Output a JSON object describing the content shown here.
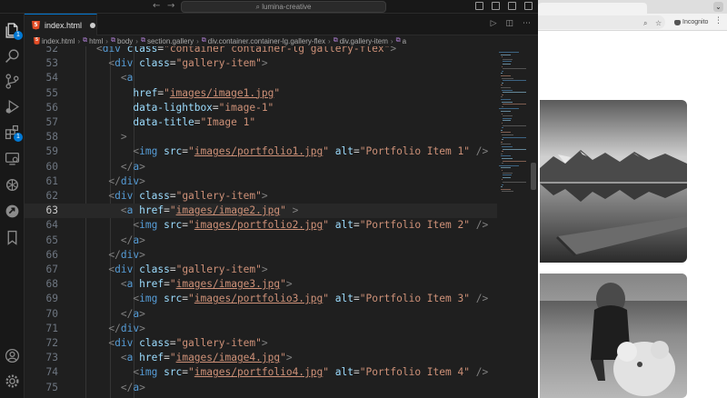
{
  "window": {
    "search_text": "lumina-creative"
  },
  "activity_bar": {
    "items": [
      {
        "name": "explorer",
        "icon": "files-icon",
        "badge": "1"
      },
      {
        "name": "search",
        "icon": "search-icon"
      },
      {
        "name": "source-control",
        "icon": "source-control-icon"
      },
      {
        "name": "run-debug",
        "icon": "run-debug-icon"
      },
      {
        "name": "extensions",
        "icon": "extensions-icon",
        "badge": "1"
      },
      {
        "name": "remote-explorer",
        "icon": "remote-explorer-icon"
      },
      {
        "name": "chatgpt",
        "icon": "openai-icon"
      },
      {
        "name": "live-share",
        "icon": "live-share-icon"
      },
      {
        "name": "bookmarks",
        "icon": "bookmark-icon"
      }
    ],
    "bottom": [
      {
        "name": "accounts",
        "icon": "account-icon"
      },
      {
        "name": "manage",
        "icon": "gear-icon"
      }
    ]
  },
  "tab": {
    "title": "index.html",
    "file_icon": "html5-icon",
    "modified": true
  },
  "breadcrumbs": [
    "index.html",
    "html",
    "body",
    "section.gallery",
    "div.container.container-lg.gallery-flex",
    "div.gallery-item",
    "a"
  ],
  "editor": {
    "current_line": 63,
    "lines": [
      {
        "n": "52",
        "text": "    <div class=\"container container-lg gallery-flex\">"
      },
      {
        "n": "53",
        "text": "      <div class=\"gallery-item\">"
      },
      {
        "n": "54",
        "text": "        <a"
      },
      {
        "n": "55",
        "text": "          href=\"images/image1.jpg\""
      },
      {
        "n": "56",
        "text": "          data-lightbox=\"image-1\""
      },
      {
        "n": "57",
        "text": "          data-title=\"Image 1\""
      },
      {
        "n": "58",
        "text": "        >"
      },
      {
        "n": "59",
        "text": "          <img src=\"images/portfolio1.jpg\" alt=\"Portfolio Item 1\" />"
      },
      {
        "n": "60",
        "text": "        </a>"
      },
      {
        "n": "61",
        "text": "      </div>"
      },
      {
        "n": "62",
        "text": "      <div class=\"gallery-item\">"
      },
      {
        "n": "63",
        "text": "        <a href=\"images/image2.jpg\" >"
      },
      {
        "n": "64",
        "text": "          <img src=\"images/portfolio2.jpg\" alt=\"Portfolio Item 2\" />"
      },
      {
        "n": "65",
        "text": "        </a>"
      },
      {
        "n": "66",
        "text": "      </div>"
      },
      {
        "n": "67",
        "text": "      <div class=\"gallery-item\">"
      },
      {
        "n": "68",
        "text": "        <a href=\"images/image3.jpg\">"
      },
      {
        "n": "69",
        "text": "          <img src=\"images/portfolio3.jpg\" alt=\"Portfolio Item 3\" />"
      },
      {
        "n": "70",
        "text": "        </a>"
      },
      {
        "n": "71",
        "text": "      </div>"
      },
      {
        "n": "72",
        "text": "      <div class=\"gallery-item\">"
      },
      {
        "n": "73",
        "text": "        <a href=\"images/image4.jpg\">"
      },
      {
        "n": "74",
        "text": "          <img src=\"images/portfolio4.jpg\" alt=\"Portfolio Item 4\" />"
      },
      {
        "n": "75",
        "text": "        </a>"
      }
    ]
  },
  "browser": {
    "incognito_label": "Incognito",
    "images": [
      {
        "name": "gallery-image-mountain-lake",
        "subject": "mountain lake with pier (grayscale)"
      },
      {
        "name": "gallery-image-girl-with-teddy-bear",
        "subject": "child with teddy bear (grayscale)"
      }
    ]
  },
  "colors": {
    "editor_bg": "#1f1f1f",
    "tag": "#569cd6",
    "attribute": "#9cdcfe",
    "string": "#ce9178",
    "accent": "#0078d4"
  }
}
